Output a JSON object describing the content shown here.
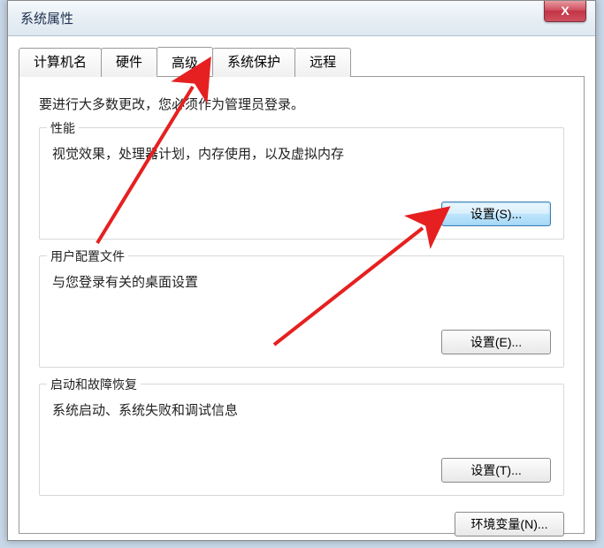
{
  "window": {
    "title": "系统属性",
    "close_label": "X"
  },
  "tabs": {
    "computer_name": "计算机名",
    "hardware": "硬件",
    "advanced": "高级",
    "system_protection": "系统保护",
    "remote": "远程"
  },
  "panel": {
    "intro": "要进行大多数更改，您必须作为管理员登录。",
    "performance": {
      "title": "性能",
      "desc": "视觉效果，处理器计划，内存使用，以及虚拟内存",
      "button": "设置(S)..."
    },
    "user_profiles": {
      "title": "用户配置文件",
      "desc": "与您登录有关的桌面设置",
      "button": "设置(E)..."
    },
    "startup_recovery": {
      "title": "启动和故障恢复",
      "desc": "系统启动、系统失败和调试信息",
      "button": "设置(T)..."
    },
    "env_vars_button": "环境变量(N)..."
  }
}
